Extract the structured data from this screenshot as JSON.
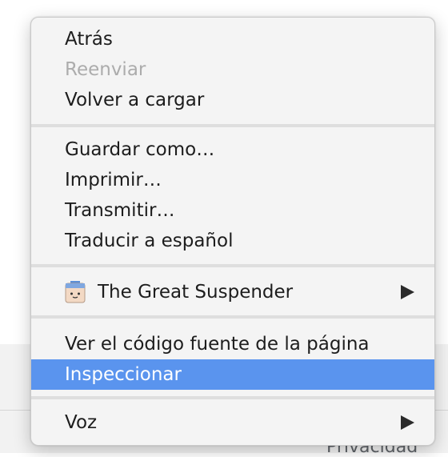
{
  "context_menu": {
    "groups": [
      {
        "items": [
          {
            "label": "Atrás",
            "enabled": true
          },
          {
            "label": "Reenviar",
            "enabled": false
          },
          {
            "label": "Volver a cargar",
            "enabled": true
          }
        ]
      },
      {
        "items": [
          {
            "label": "Guardar como…",
            "enabled": true
          },
          {
            "label": "Imprimir…",
            "enabled": true
          },
          {
            "label": "Transmitir…",
            "enabled": true
          },
          {
            "label": "Traducir a español",
            "enabled": true
          }
        ]
      },
      {
        "items": [
          {
            "label": "The Great Suspender",
            "enabled": true,
            "icon": "great-suspender-icon",
            "has_submenu": true
          }
        ]
      },
      {
        "items": [
          {
            "label": "Ver el código fuente de la página",
            "enabled": true
          },
          {
            "label": "Inspeccionar",
            "enabled": true,
            "highlighted": true
          }
        ]
      },
      {
        "items": [
          {
            "label": "Voz",
            "enabled": true,
            "has_submenu": true
          }
        ]
      }
    ]
  },
  "background_page": {
    "footer_link": "Privacidad"
  },
  "colors": {
    "highlight": "#5a94ee",
    "menu_background": "#f4f4f4",
    "disabled_text": "#acacac"
  }
}
